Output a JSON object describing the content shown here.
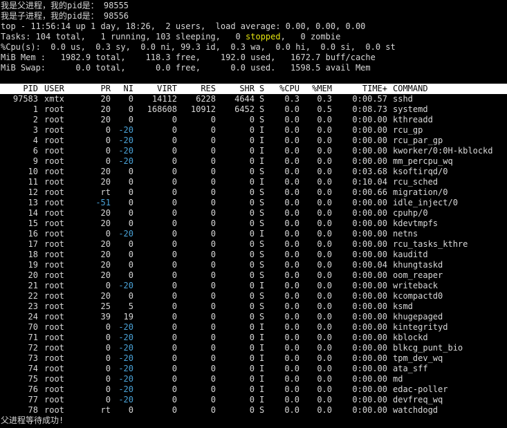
{
  "pre_lines": {
    "parent_pid": "我是父进程，我的pid是： 98555",
    "child_pid": "我是子进程，我的pid是： 98556"
  },
  "summary": {
    "top_line": "top - 11:56:14 up 1 day, 18:26,  2 users,  load average: 0.00, 0.00, 0.00",
    "tasks_prefix": "Tasks: 104 total,   1 running, 103 sleeping,   0 ",
    "tasks_stopped": "stopped",
    "tasks_suffix": ",   0 zombie",
    "cpu_line": "%Cpu(s):  0.0 us,  0.3 sy,  0.0 ni, 99.3 id,  0.3 wa,  0.0 hi,  0.0 si,  0.0 st",
    "mem_line": "MiB Mem :   1982.9 total,    118.3 free,    192.0 used,   1672.7 buff/cache",
    "swap_line": "MiB Swap:      0.0 total,      0.0 free,      0.0 used.   1598.5 avail Mem"
  },
  "colors": {
    "background": "#000000",
    "text": "#d8d8d8",
    "header_bg": "#ffffff",
    "negative_ni": "#4aa3d8",
    "stopped": "#e5e510"
  },
  "table": {
    "columns": [
      "PID",
      "USER",
      "PR",
      "NI",
      "VIRT",
      "RES",
      "SHR",
      "S",
      "%CPU",
      "%MEM",
      "TIME+",
      "COMMAND"
    ],
    "rows": [
      {
        "pid": "97583",
        "user": "xmtx",
        "pr": "20",
        "ni": "0",
        "virt": "14112",
        "res": "6228",
        "shr": "4644",
        "s": "S",
        "cpu": "0.3",
        "mem": "0.3",
        "time": "0:00.57",
        "cmd": "sshd"
      },
      {
        "pid": "1",
        "user": "root",
        "pr": "20",
        "ni": "0",
        "virt": "168608",
        "res": "10912",
        "shr": "6452",
        "s": "S",
        "cpu": "0.0",
        "mem": "0.5",
        "time": "0:08.73",
        "cmd": "systemd"
      },
      {
        "pid": "2",
        "user": "root",
        "pr": "20",
        "ni": "0",
        "virt": "0",
        "res": "0",
        "shr": "0",
        "s": "S",
        "cpu": "0.0",
        "mem": "0.0",
        "time": "0:00.00",
        "cmd": "kthreadd"
      },
      {
        "pid": "3",
        "user": "root",
        "pr": "0",
        "ni": "-20",
        "virt": "0",
        "res": "0",
        "shr": "0",
        "s": "I",
        "cpu": "0.0",
        "mem": "0.0",
        "time": "0:00.00",
        "cmd": "rcu_gp"
      },
      {
        "pid": "4",
        "user": "root",
        "pr": "0",
        "ni": "-20",
        "virt": "0",
        "res": "0",
        "shr": "0",
        "s": "I",
        "cpu": "0.0",
        "mem": "0.0",
        "time": "0:00.00",
        "cmd": "rcu_par_gp"
      },
      {
        "pid": "6",
        "user": "root",
        "pr": "0",
        "ni": "-20",
        "virt": "0",
        "res": "0",
        "shr": "0",
        "s": "I",
        "cpu": "0.0",
        "mem": "0.0",
        "time": "0:00.00",
        "cmd": "kworker/0:0H-kblockd"
      },
      {
        "pid": "9",
        "user": "root",
        "pr": "0",
        "ni": "-20",
        "virt": "0",
        "res": "0",
        "shr": "0",
        "s": "I",
        "cpu": "0.0",
        "mem": "0.0",
        "time": "0:00.00",
        "cmd": "mm_percpu_wq"
      },
      {
        "pid": "10",
        "user": "root",
        "pr": "20",
        "ni": "0",
        "virt": "0",
        "res": "0",
        "shr": "0",
        "s": "S",
        "cpu": "0.0",
        "mem": "0.0",
        "time": "0:03.68",
        "cmd": "ksoftirqd/0"
      },
      {
        "pid": "11",
        "user": "root",
        "pr": "20",
        "ni": "0",
        "virt": "0",
        "res": "0",
        "shr": "0",
        "s": "I",
        "cpu": "0.0",
        "mem": "0.0",
        "time": "0:10.04",
        "cmd": "rcu_sched"
      },
      {
        "pid": "12",
        "user": "root",
        "pr": "rt",
        "ni": "0",
        "virt": "0",
        "res": "0",
        "shr": "0",
        "s": "S",
        "cpu": "0.0",
        "mem": "0.0",
        "time": "0:00.66",
        "cmd": "migration/0"
      },
      {
        "pid": "13",
        "user": "root",
        "pr": "-51",
        "ni": "0",
        "virt": "0",
        "res": "0",
        "shr": "0",
        "s": "S",
        "cpu": "0.0",
        "mem": "0.0",
        "time": "0:00.00",
        "cmd": "idle_inject/0"
      },
      {
        "pid": "14",
        "user": "root",
        "pr": "20",
        "ni": "0",
        "virt": "0",
        "res": "0",
        "shr": "0",
        "s": "S",
        "cpu": "0.0",
        "mem": "0.0",
        "time": "0:00.00",
        "cmd": "cpuhp/0"
      },
      {
        "pid": "15",
        "user": "root",
        "pr": "20",
        "ni": "0",
        "virt": "0",
        "res": "0",
        "shr": "0",
        "s": "S",
        "cpu": "0.0",
        "mem": "0.0",
        "time": "0:00.00",
        "cmd": "kdevtmpfs"
      },
      {
        "pid": "16",
        "user": "root",
        "pr": "0",
        "ni": "-20",
        "virt": "0",
        "res": "0",
        "shr": "0",
        "s": "I",
        "cpu": "0.0",
        "mem": "0.0",
        "time": "0:00.00",
        "cmd": "netns"
      },
      {
        "pid": "17",
        "user": "root",
        "pr": "20",
        "ni": "0",
        "virt": "0",
        "res": "0",
        "shr": "0",
        "s": "S",
        "cpu": "0.0",
        "mem": "0.0",
        "time": "0:00.00",
        "cmd": "rcu_tasks_kthre"
      },
      {
        "pid": "18",
        "user": "root",
        "pr": "20",
        "ni": "0",
        "virt": "0",
        "res": "0",
        "shr": "0",
        "s": "S",
        "cpu": "0.0",
        "mem": "0.0",
        "time": "0:00.00",
        "cmd": "kauditd"
      },
      {
        "pid": "19",
        "user": "root",
        "pr": "20",
        "ni": "0",
        "virt": "0",
        "res": "0",
        "shr": "0",
        "s": "S",
        "cpu": "0.0",
        "mem": "0.0",
        "time": "0:00.04",
        "cmd": "khungtaskd"
      },
      {
        "pid": "20",
        "user": "root",
        "pr": "20",
        "ni": "0",
        "virt": "0",
        "res": "0",
        "shr": "0",
        "s": "S",
        "cpu": "0.0",
        "mem": "0.0",
        "time": "0:00.00",
        "cmd": "oom_reaper"
      },
      {
        "pid": "21",
        "user": "root",
        "pr": "0",
        "ni": "-20",
        "virt": "0",
        "res": "0",
        "shr": "0",
        "s": "I",
        "cpu": "0.0",
        "mem": "0.0",
        "time": "0:00.00",
        "cmd": "writeback"
      },
      {
        "pid": "22",
        "user": "root",
        "pr": "20",
        "ni": "0",
        "virt": "0",
        "res": "0",
        "shr": "0",
        "s": "S",
        "cpu": "0.0",
        "mem": "0.0",
        "time": "0:00.00",
        "cmd": "kcompactd0"
      },
      {
        "pid": "23",
        "user": "root",
        "pr": "25",
        "ni": "5",
        "virt": "0",
        "res": "0",
        "shr": "0",
        "s": "S",
        "cpu": "0.0",
        "mem": "0.0",
        "time": "0:00.00",
        "cmd": "ksmd"
      },
      {
        "pid": "24",
        "user": "root",
        "pr": "39",
        "ni": "19",
        "virt": "0",
        "res": "0",
        "shr": "0",
        "s": "S",
        "cpu": "0.0",
        "mem": "0.0",
        "time": "0:00.00",
        "cmd": "khugepaged"
      },
      {
        "pid": "70",
        "user": "root",
        "pr": "0",
        "ni": "-20",
        "virt": "0",
        "res": "0",
        "shr": "0",
        "s": "I",
        "cpu": "0.0",
        "mem": "0.0",
        "time": "0:00.00",
        "cmd": "kintegrityd"
      },
      {
        "pid": "71",
        "user": "root",
        "pr": "0",
        "ni": "-20",
        "virt": "0",
        "res": "0",
        "shr": "0",
        "s": "I",
        "cpu": "0.0",
        "mem": "0.0",
        "time": "0:00.00",
        "cmd": "kblockd"
      },
      {
        "pid": "72",
        "user": "root",
        "pr": "0",
        "ni": "-20",
        "virt": "0",
        "res": "0",
        "shr": "0",
        "s": "I",
        "cpu": "0.0",
        "mem": "0.0",
        "time": "0:00.00",
        "cmd": "blkcg_punt_bio"
      },
      {
        "pid": "73",
        "user": "root",
        "pr": "0",
        "ni": "-20",
        "virt": "0",
        "res": "0",
        "shr": "0",
        "s": "I",
        "cpu": "0.0",
        "mem": "0.0",
        "time": "0:00.00",
        "cmd": "tpm_dev_wq"
      },
      {
        "pid": "74",
        "user": "root",
        "pr": "0",
        "ni": "-20",
        "virt": "0",
        "res": "0",
        "shr": "0",
        "s": "I",
        "cpu": "0.0",
        "mem": "0.0",
        "time": "0:00.00",
        "cmd": "ata_sff"
      },
      {
        "pid": "75",
        "user": "root",
        "pr": "0",
        "ni": "-20",
        "virt": "0",
        "res": "0",
        "shr": "0",
        "s": "I",
        "cpu": "0.0",
        "mem": "0.0",
        "time": "0:00.00",
        "cmd": "md"
      },
      {
        "pid": "76",
        "user": "root",
        "pr": "0",
        "ni": "-20",
        "virt": "0",
        "res": "0",
        "shr": "0",
        "s": "I",
        "cpu": "0.0",
        "mem": "0.0",
        "time": "0:00.00",
        "cmd": "edac-poller"
      },
      {
        "pid": "77",
        "user": "root",
        "pr": "0",
        "ni": "-20",
        "virt": "0",
        "res": "0",
        "shr": "0",
        "s": "I",
        "cpu": "0.0",
        "mem": "0.0",
        "time": "0:00.00",
        "cmd": "devfreq_wq"
      },
      {
        "pid": "78",
        "user": "root",
        "pr": "rt",
        "ni": "0",
        "virt": "0",
        "res": "0",
        "shr": "0",
        "s": "S",
        "cpu": "0.0",
        "mem": "0.0",
        "time": "0:00.00",
        "cmd": "watchdogd"
      }
    ]
  },
  "post_lines": {
    "wait_success": "父进程等待成功!"
  }
}
